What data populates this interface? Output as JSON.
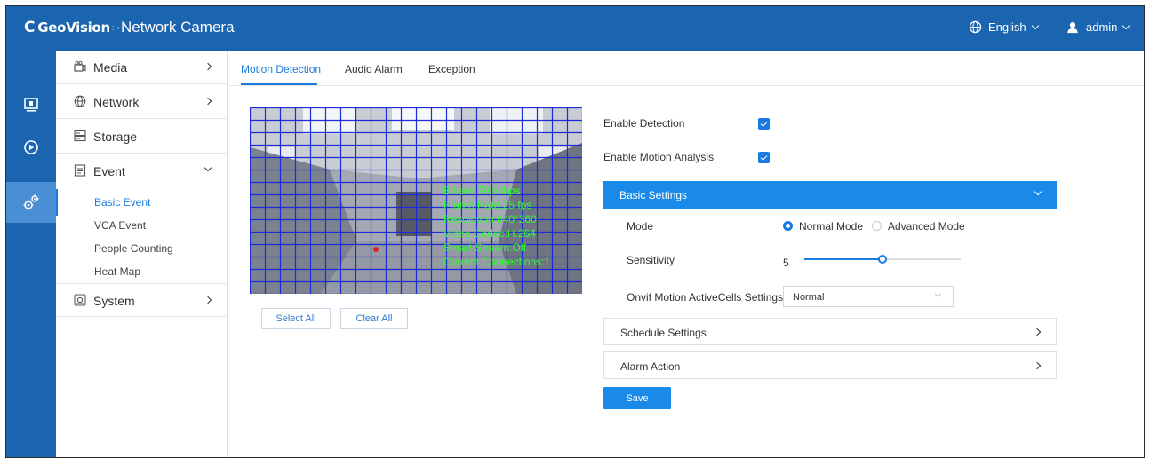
{
  "header": {
    "brand_mark": "GeoVision",
    "brand_sep": ":",
    "title": "·Network Camera",
    "language": "English",
    "user": "admin",
    "colors": {
      "topbar": "#1a64b0",
      "accent": "#1a7ae0"
    }
  },
  "rail": {
    "items": [
      {
        "icon": "monitor-icon"
      },
      {
        "icon": "play-icon"
      },
      {
        "icon": "settings-gears-icon",
        "active": true
      }
    ]
  },
  "nav": {
    "items": [
      {
        "label": "Media",
        "icon": "media-icon"
      },
      {
        "label": "Network",
        "icon": "globe-icon"
      },
      {
        "label": "Storage",
        "icon": "storage-icon"
      },
      {
        "label": "Event",
        "icon": "event-icon"
      },
      {
        "label": "System",
        "icon": "system-icon"
      }
    ],
    "event_sub": [
      "Basic Event",
      "VCA Event",
      "People Counting",
      "Heat Map"
    ]
  },
  "tabs": [
    "Motion Detection",
    "Audio Alarm",
    "Exception"
  ],
  "video": {
    "osd": [
      "Bitrate:79.5kbps",
      "Frame Rate:25 fps",
      "Resolution:640*360",
      "Video Codec:H.264",
      "Smart Stream:Off",
      "Current Connections:1"
    ]
  },
  "buttons": {
    "select_all": "Select All",
    "clear_all": "Clear All",
    "save": "Save"
  },
  "form": {
    "enable_detection": "Enable Detection",
    "enable_motion_analysis": "Enable Motion Analysis",
    "basic_settings": "Basic Settings",
    "mode_label": "Mode",
    "mode_normal": "Normal Mode",
    "mode_advanced": "Advanced Mode",
    "sensitivity_label": "Sensitivity",
    "sensitivity_value": "5",
    "sensitivity_fraction": 0.5,
    "onvif_label": "Onvif Motion ActiveCells Settings",
    "onvif_value": "Normal",
    "schedule_settings": "Schedule Settings",
    "alarm_action": "Alarm Action"
  }
}
